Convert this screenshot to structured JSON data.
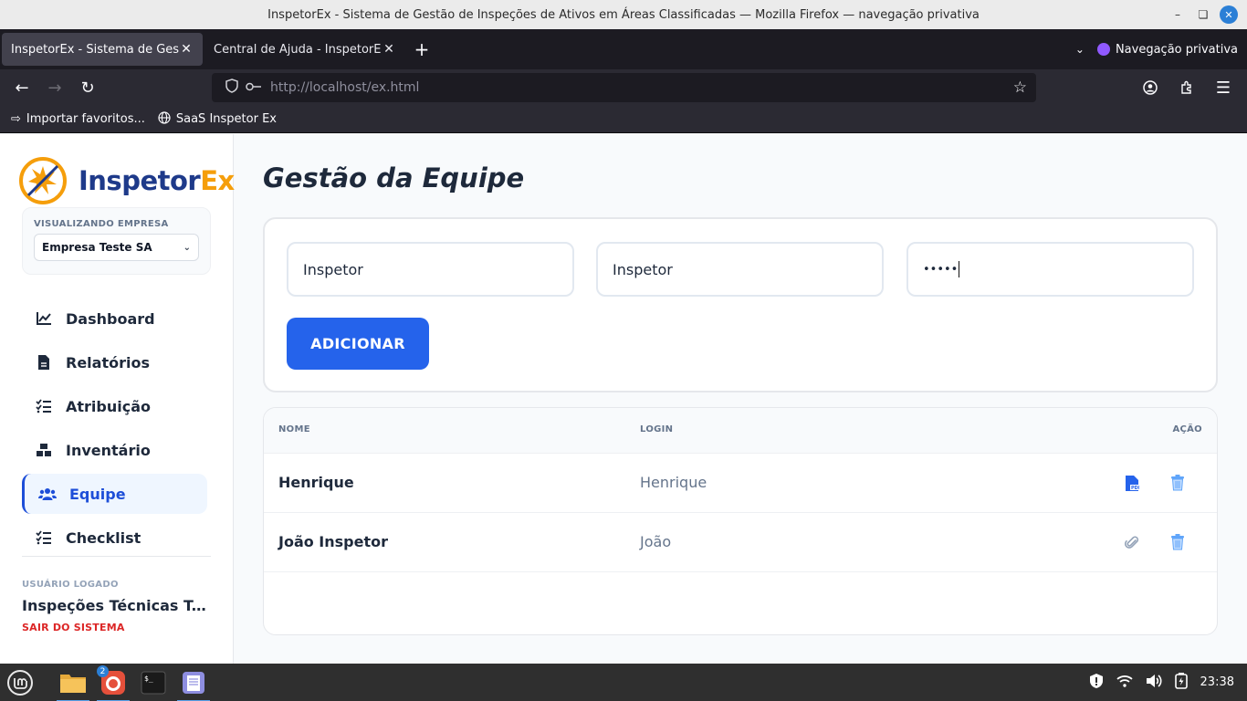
{
  "window": {
    "title": "InspetorEx - Sistema de Gestão de Inspeções de Ativos em Áreas Classificadas — Mozilla Firefox — navegação privativa"
  },
  "browser": {
    "tabs": [
      {
        "label": "InspetorEx - Sistema de Gestão d",
        "active": true
      },
      {
        "label": "Central de Ajuda - InspetorEx",
        "active": false
      }
    ],
    "private_label": "Navegação privativa",
    "url": "http://localhost/ex.html",
    "bookmarks": [
      {
        "label": "Importar favoritos...",
        "icon": "import-icon"
      },
      {
        "label": "SaaS Inspetor Ex",
        "icon": "globe-icon"
      }
    ]
  },
  "app": {
    "brand": {
      "part1": "Inspetor",
      "part2": "Ex"
    },
    "company": {
      "label": "VISUALIZANDO EMPRESA",
      "selected": "Empresa Teste SA"
    },
    "menu": [
      {
        "label": "Dashboard",
        "icon": "chart-line-icon",
        "active": false
      },
      {
        "label": "Relatórios",
        "icon": "file-icon",
        "active": false
      },
      {
        "label": "Atribuição",
        "icon": "list-check-icon",
        "active": false
      },
      {
        "label": "Inventário",
        "icon": "boxes-icon",
        "active": false
      },
      {
        "label": "Equipe",
        "icon": "users-icon",
        "active": true
      },
      {
        "label": "Checklist",
        "icon": "list-check-icon",
        "active": false
      }
    ],
    "user": {
      "label": "USUÁRIO LOGADO",
      "name": "Inspeções Técnicas Terceirizadas",
      "logout": "SAIR DO SISTEMA"
    }
  },
  "main": {
    "title": "Gestão da Equipe",
    "form": {
      "name_value": "Inspetor",
      "login_value": "Inspetor",
      "password_value": "•••••",
      "add_label": "ADICIONAR"
    },
    "table": {
      "headers": [
        "NOME",
        "LOGIN",
        "AÇÃO"
      ],
      "rows": [
        {
          "name": "Henrique",
          "login": "Henrique",
          "doc_icon": "pdf-file-icon"
        },
        {
          "name": "João Inspetor",
          "login": "João",
          "doc_icon": "paperclip-icon"
        }
      ]
    }
  },
  "taskbar": {
    "firefox_badge": "2",
    "clock": "23:38"
  },
  "colors": {
    "primary": "#2563eb",
    "brand_dark": "#1e3a8a",
    "brand_orange": "#f59e0b",
    "danger": "#dc2626"
  }
}
